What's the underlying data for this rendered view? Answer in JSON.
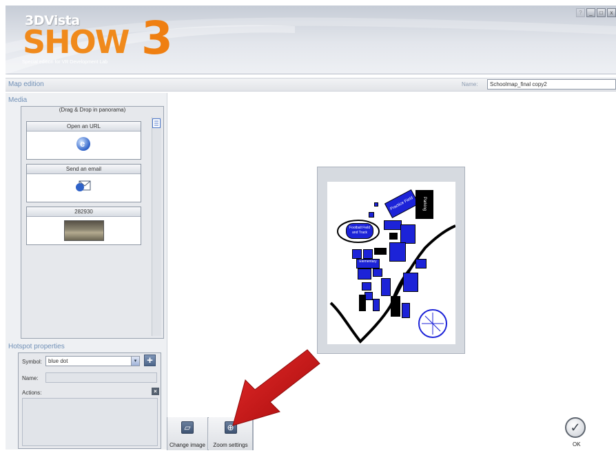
{
  "header": {
    "brand_top": "3DVista",
    "brand_main": "SHOW",
    "brand_number": "3",
    "brand_sub": "Special edition for VR Development Lab"
  },
  "section": {
    "title": "Map edition",
    "name_label": "Name:",
    "name_value": "Schoolmap_final copy2"
  },
  "media": {
    "title": "Media",
    "header": "(Drag & Drop in panorama)",
    "items": [
      {
        "label": "Open an URL",
        "icon": "globe-icon"
      },
      {
        "label": "Send an email",
        "icon": "email-icon"
      },
      {
        "label": "282930",
        "icon": "panorama-thumbnail"
      }
    ]
  },
  "hotspot": {
    "title": "Hotspot properties",
    "symbol_label": "Symbol:",
    "symbol_value": "blue dot",
    "name_label": "Name:",
    "actions_label": "Actions:"
  },
  "toolbar": {
    "change_image": "Change image",
    "zoom_settings": "Zoom settings"
  },
  "ok": {
    "label": "OK"
  },
  "map": {
    "labels": {
      "football": "Football Field and Track",
      "practice": "Practice Field",
      "parking": "Parking",
      "elementary": "Elementary"
    }
  },
  "colors": {
    "accent": "#6f8fb6",
    "logo_orange": "#f08a1c",
    "map_blue": "#1c23d8",
    "arrow_red": "#d01616"
  }
}
